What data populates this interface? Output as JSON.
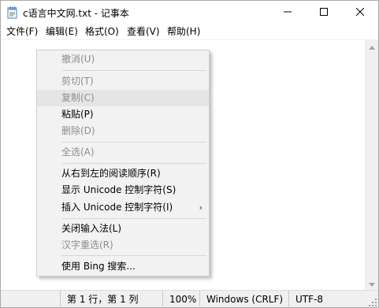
{
  "window": {
    "title": "c语言中文网.txt - 记事本"
  },
  "menu": [
    "文件(F)",
    "编辑(E)",
    "格式(O)",
    "查看(V)",
    "帮助(H)"
  ],
  "context_menu": {
    "items": [
      {
        "label": "撤消(U)",
        "enabled": false
      },
      {
        "label": "剪切(T)",
        "enabled": false
      },
      {
        "label": "复制(C)",
        "enabled": false
      },
      {
        "label": "粘贴(P)",
        "enabled": true
      },
      {
        "label": "删除(D)",
        "enabled": false
      },
      {
        "label": "全选(A)",
        "enabled": false
      },
      {
        "label": "从右到左的阅读顺序(R)",
        "enabled": true
      },
      {
        "label": "显示 Unicode 控制字符(S)",
        "enabled": true
      },
      {
        "label": "插入 Unicode 控制字符(I)",
        "enabled": true
      },
      {
        "label": "关闭输入法(L)",
        "enabled": true
      },
      {
        "label": "汉字重选(R)",
        "enabled": false
      },
      {
        "label": "使用 Bing 搜索...",
        "enabled": true
      }
    ],
    "submenu_arrow": "›"
  },
  "statusbar": {
    "position": "第 1 行，第 1 列",
    "zoom": "100%",
    "line_ending": "Windows (CRLF)",
    "encoding": "UTF-8"
  },
  "colors": {
    "disabled_text": "#8d8d8d",
    "menu_bg": "#f2f2f2",
    "status_bg": "#f0f0f0"
  },
  "icons": [
    "notepad-icon",
    "minimize-icon",
    "maximize-icon",
    "close-icon",
    "scroll-up-icon",
    "scroll-down-icon",
    "chevron-right-icon",
    "size-grip-icon"
  ]
}
